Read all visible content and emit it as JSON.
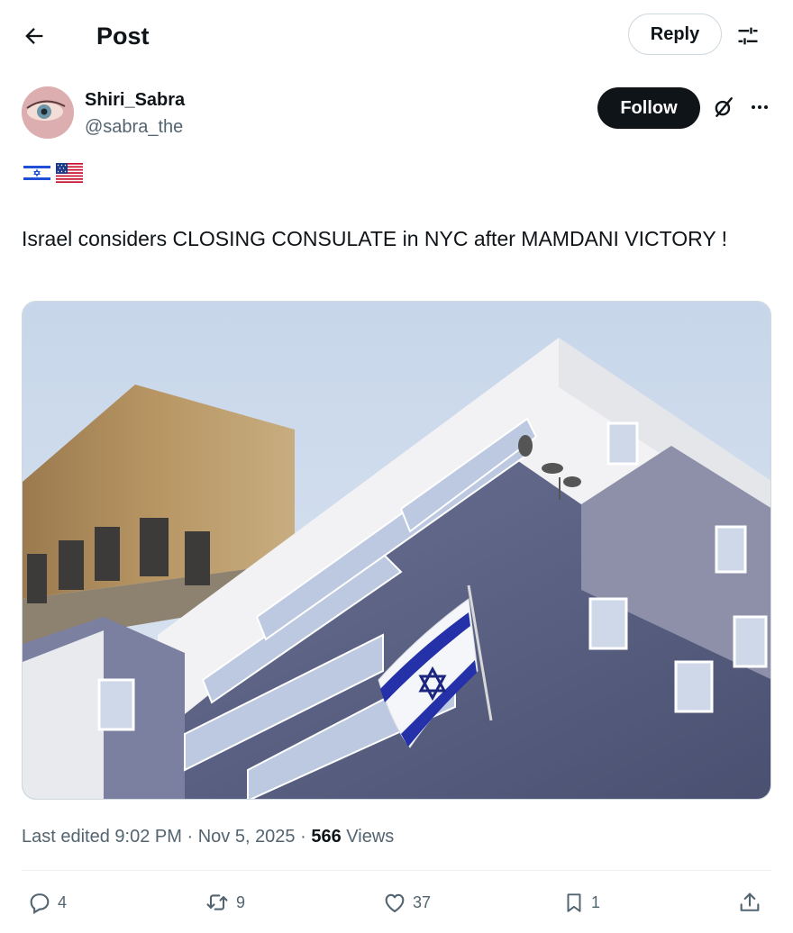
{
  "header": {
    "title": "Post",
    "reply_label": "Reply"
  },
  "author": {
    "display_name": "Shiri_Sabra",
    "handle": "@sabra_the",
    "follow_label": "Follow",
    "bio_flags": [
      "israel-flag",
      "usa-flag"
    ]
  },
  "post": {
    "text": "Israel considers CLOSING CONSULATE in NYC after MAMDANI VICTORY !",
    "media": {
      "kind": "photo",
      "subject": "Israeli flag on building facade"
    }
  },
  "meta": {
    "edited_prefix": "Last edited",
    "time": "9:02 PM",
    "date": "Nov 5, 2025",
    "views_count": "566",
    "views_label": "Views"
  },
  "actions": {
    "replies": "4",
    "reposts": "9",
    "likes": "37",
    "bookmarks": "1"
  },
  "colors": {
    "text_primary": "#0f1419",
    "text_secondary": "#536471",
    "follow_bg": "#0f1419",
    "border": "#cfd9de"
  }
}
